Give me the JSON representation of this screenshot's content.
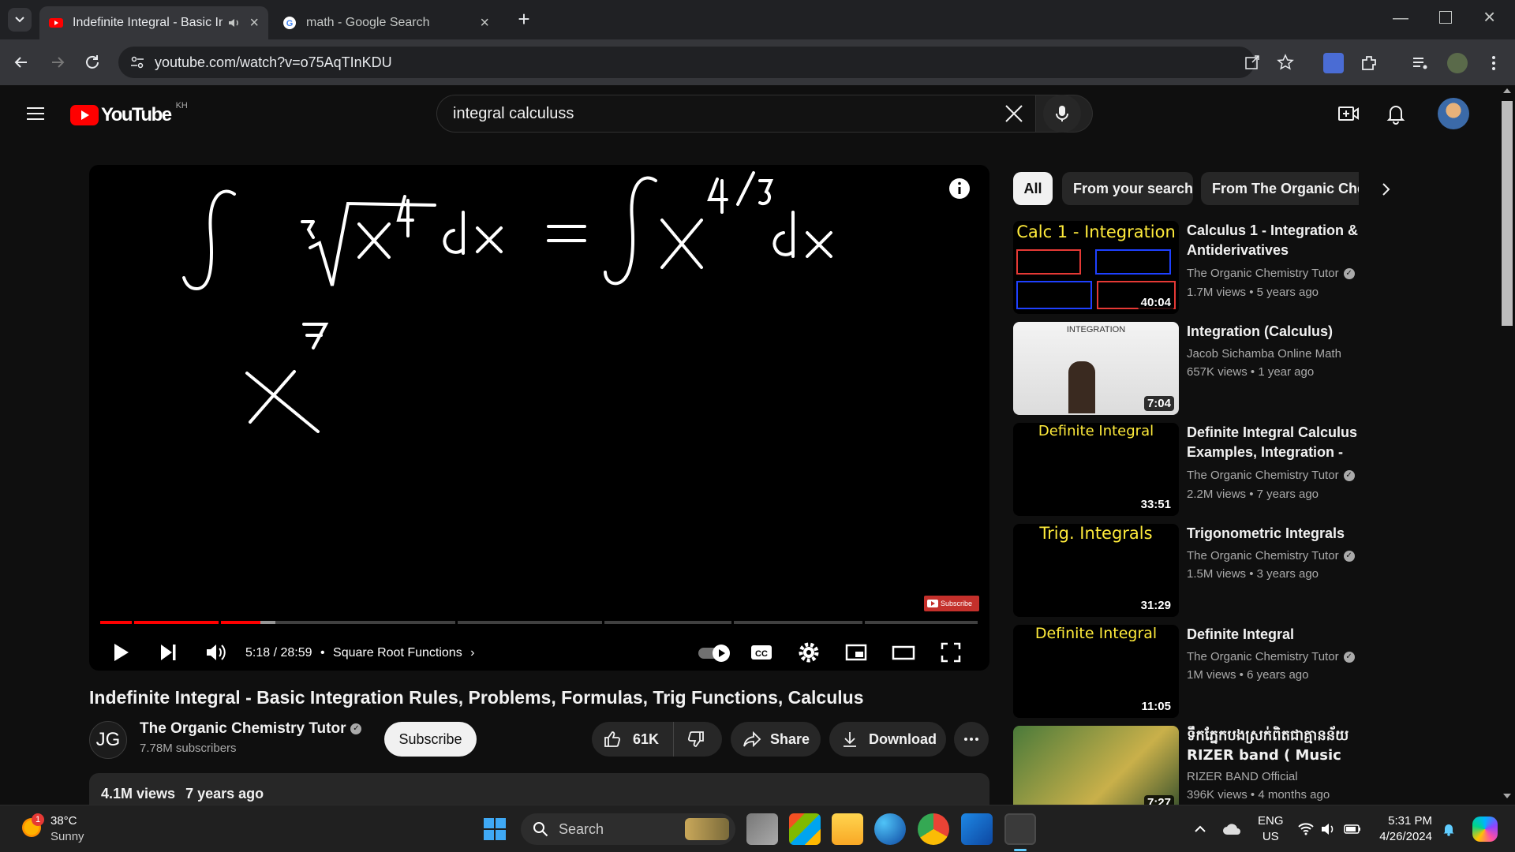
{
  "browser": {
    "tabs": [
      {
        "title": "Indefinite Integral - Basic In",
        "active": true,
        "favicon": "youtube-icon"
      },
      {
        "title": "math - Google Search",
        "active": false,
        "favicon": "google-icon"
      }
    ],
    "url": "youtube.com/watch?v=o75AqTInKDU"
  },
  "youtube": {
    "logo_text": "YouTube",
    "region": "KH",
    "search_query": "integral calculuss"
  },
  "player": {
    "current_time": "5:18",
    "duration": "28:59",
    "chapter": "Square Root Functions",
    "progress_fraction": 0.183,
    "buffered_fraction": 0.2,
    "watermark": "Subscribe"
  },
  "video": {
    "title": "Indefinite Integral - Basic Integration Rules, Problems, Formulas, Trig Functions, Calculus",
    "channel_initials": "JG",
    "channel_name": "The Organic Chemistry Tutor",
    "subscribers": "7.78M subscribers",
    "subscribe_label": "Subscribe",
    "likes": "61K",
    "share_label": "Share",
    "download_label": "Download",
    "views": "4.1M views",
    "age": "7 years ago"
  },
  "chips": [
    "All",
    "From your search",
    "From The Organic Chem"
  ],
  "recommendations": [
    {
      "title": "Calculus 1 - Integration & Antiderivatives",
      "channel": "The Organic Chemistry Tutor",
      "verified": true,
      "views": "1.7M views",
      "age": "5 years ago",
      "duration": "40:04",
      "thumb_heading": "Calc 1 - Integration"
    },
    {
      "title": "Integration (Calculus)",
      "channel": "Jacob Sichamba Online Math",
      "verified": false,
      "views": "657K views",
      "age": "1 year ago",
      "duration": "7:04",
      "thumb_heading": "INTEGRATION"
    },
    {
      "title": "Definite Integral Calculus Examples, Integration - Basic...",
      "channel": "The Organic Chemistry Tutor",
      "verified": true,
      "views": "2.2M views",
      "age": "7 years ago",
      "duration": "33:51",
      "thumb_heading": "Definite Integral"
    },
    {
      "title": "Trigonometric Integrals",
      "channel": "The Organic Chemistry Tutor",
      "verified": true,
      "views": "1.5M views",
      "age": "3 years ago",
      "duration": "31:29",
      "thumb_heading": "Trig. Integrals"
    },
    {
      "title": "Definite Integral",
      "channel": "The Organic Chemistry Tutor",
      "verified": true,
      "views": "1M views",
      "age": "6 years ago",
      "duration": "11:05",
      "thumb_heading": "Definite Integral"
    },
    {
      "title": "ទឹកភ្នែកបងស្រក់ពិតជាគ្មានន័យ RIZER band ( Music Video )",
      "channel": "RIZER BAND Official",
      "verified": false,
      "views": "396K views",
      "age": "4 months ago",
      "duration": "7:27",
      "thumb_heading": ""
    }
  ],
  "taskbar": {
    "weather_temp": "38°C",
    "weather_desc": "Sunny",
    "weather_badge": "1",
    "search_label": "Search",
    "lang_top": "ENG",
    "lang_bottom": "US",
    "time": "5:31 PM",
    "date": "4/26/2024"
  },
  "colors": {
    "youtube_red": "#ff0000",
    "progress_red": "#ff0000",
    "background": "#0f0f0f"
  }
}
